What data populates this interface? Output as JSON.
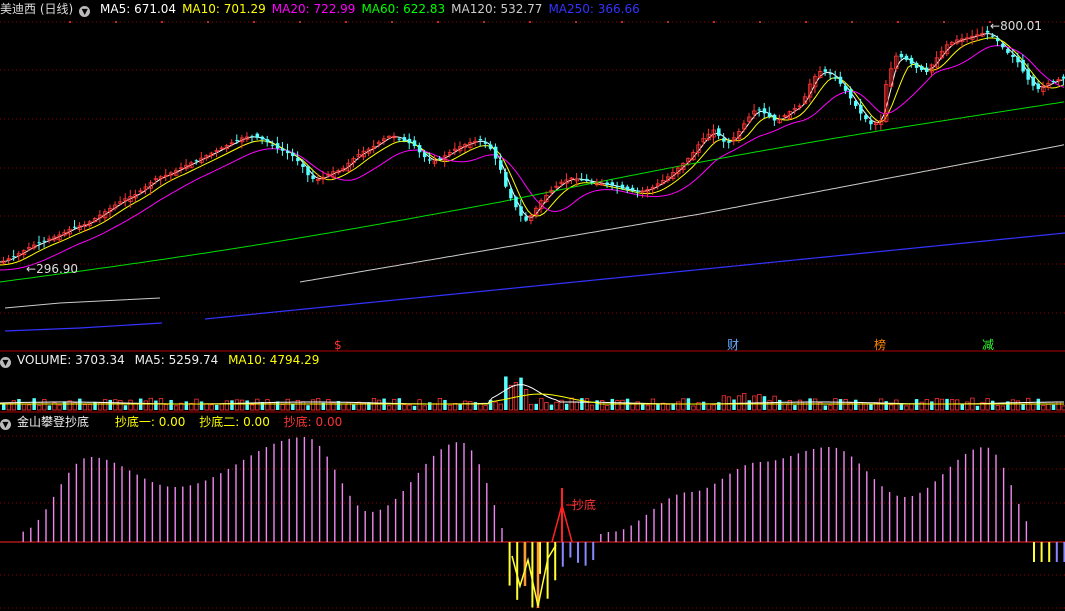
{
  "main_panel": {
    "title": "美迪西 (日线)",
    "indicators": [
      {
        "label": "MA5: 671.04",
        "color": "#ffffff"
      },
      {
        "label": "MA10: 701.29",
        "color": "#ffff00"
      },
      {
        "label": "MA20: 722.99",
        "color": "#ff00ff"
      },
      {
        "label": "MA60: 622.83",
        "color": "#00ff00"
      },
      {
        "label": "MA120: 532.77",
        "color": "#cccccc"
      },
      {
        "label": "MA250: 366.66",
        "color": "#3333ff"
      }
    ],
    "high_label": "800.01",
    "low_label": "296.90",
    "event_markers": [
      {
        "text": "$",
        "color": "#ff3333"
      },
      {
        "text": "财",
        "color": "#66aaff"
      },
      {
        "text": "榜",
        "color": "#ff8800"
      },
      {
        "text": "减",
        "color": "#33ff33"
      }
    ]
  },
  "volume_panel": {
    "title": "VOLUME: 3703.34",
    "ma5": "MA5: 5259.74",
    "ma10": "MA10: 4794.29"
  },
  "indicator_panel": {
    "title": "金山攀登抄底",
    "chaodi1": "抄底一: 0.00",
    "chaodi2": "抄底二: 0.00",
    "chaodi": "抄底: 0.00",
    "signal_label": "抄底"
  },
  "colors": {
    "up": "#ff3333",
    "down": "#54ffff",
    "grid": "#8b0000",
    "border": "#b00000",
    "histogram": "#ee88ee"
  }
}
